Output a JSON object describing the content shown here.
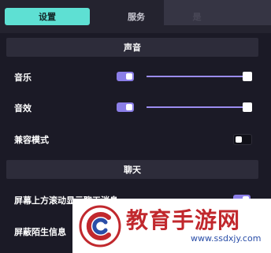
{
  "tabs": [
    {
      "label": "设置",
      "active": true
    },
    {
      "label": "服务",
      "active": false
    },
    {
      "label": "是",
      "active": false
    }
  ],
  "sections": {
    "sound": "声音",
    "chat": "聊天"
  },
  "settings": {
    "music": {
      "label": "音乐",
      "enabled": true,
      "volume": 1.0
    },
    "sfx": {
      "label": "音效",
      "enabled": true,
      "volume": 1.0
    },
    "compat": {
      "label": "兼容模式",
      "enabled": false
    },
    "scroll_chat": {
      "label": "屏幕上方滚动显示聊天消息",
      "enabled": true
    },
    "block_stranger": {
      "label": "屏蔽陌生信息"
    }
  },
  "watermark": {
    "title": "教育手游网",
    "url": "www.ssdxjy.com"
  },
  "colors": {
    "accent_tab": "#5ee0d3",
    "toggle_on": "#8b7ee8",
    "background": "#1b1a26",
    "section_bg": "#2d2c3a",
    "watermark_red": "#c1282d"
  }
}
